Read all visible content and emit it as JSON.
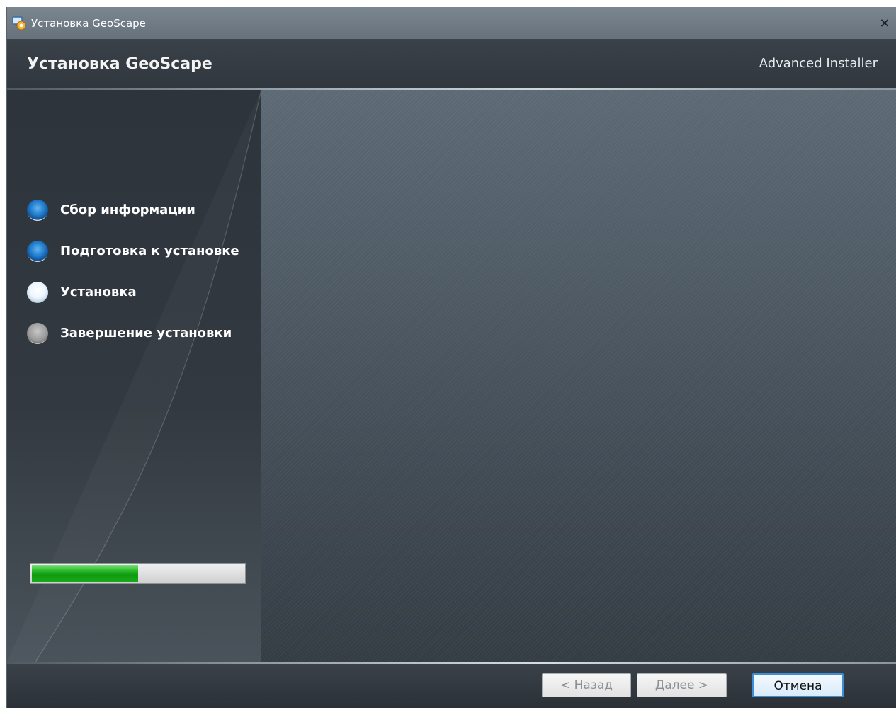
{
  "window": {
    "title": "Установка GeoScape",
    "close_glyph": "✕"
  },
  "header": {
    "title": "Установка GeoScape",
    "brand": "Advanced Installer"
  },
  "steps": [
    {
      "label": "Сбор информации",
      "state": "done"
    },
    {
      "label": "Подготовка к установке",
      "state": "done"
    },
    {
      "label": "Установка",
      "state": "current"
    },
    {
      "label": "Завершение установки",
      "state": "pending"
    }
  ],
  "progress": {
    "fraction": 0.5
  },
  "buttons": {
    "back": "< Назад",
    "next": "Далее >",
    "cancel": "Отмена"
  },
  "colors": {
    "progress_fill": "#1ba91b",
    "step_done": "#1f78c8",
    "default_button_border": "#3c8fd6"
  },
  "icons": {
    "app": "installer-app-icon",
    "close": "close-icon",
    "step_done": "step-done-icon",
    "step_current": "step-current-icon",
    "step_pending": "step-pending-icon"
  }
}
